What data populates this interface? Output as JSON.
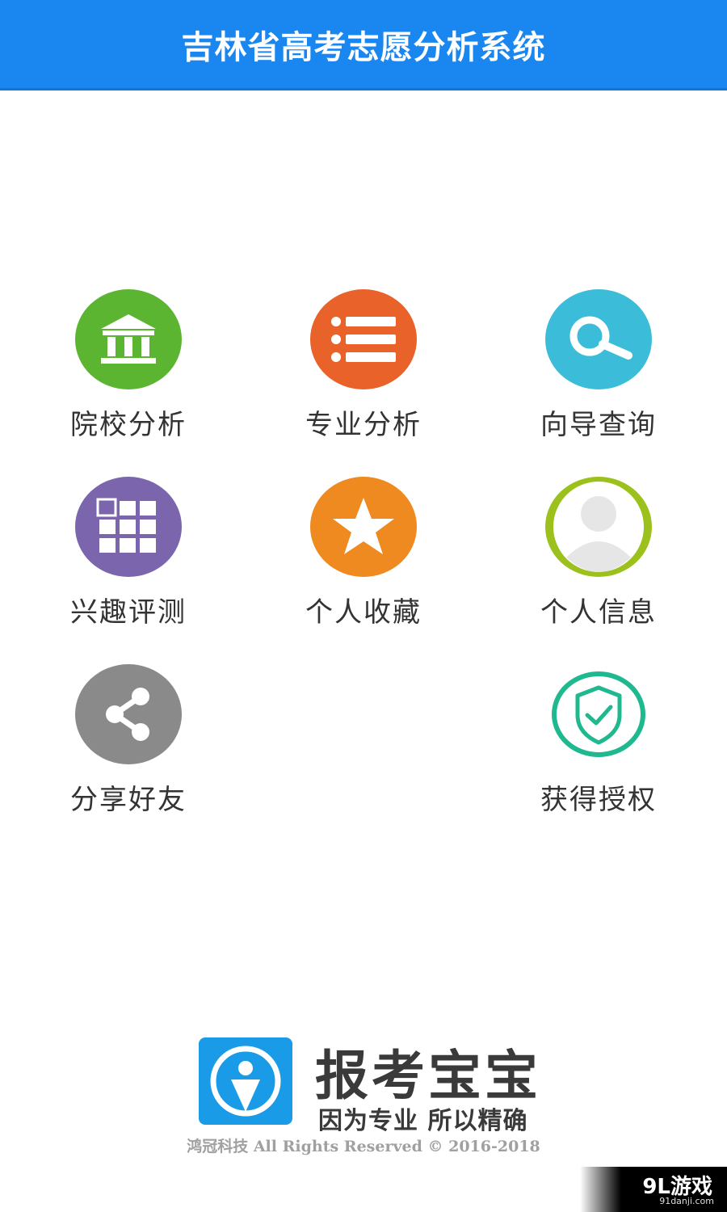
{
  "header": {
    "title": "吉林省高考志愿分析系统",
    "color": "#1a86f0"
  },
  "menu": {
    "items": [
      {
        "label": "院校分析",
        "icon": "institution-icon",
        "color": "#5cb531"
      },
      {
        "label": "专业分析",
        "icon": "list-icon",
        "color": "#e8622a"
      },
      {
        "label": "向导查询",
        "icon": "search-icon",
        "color": "#3bbcd8"
      },
      {
        "label": "兴趣评测",
        "icon": "grid-icon",
        "color": "#7b66ad"
      },
      {
        "label": "个人收藏",
        "icon": "star-icon",
        "color": "#ee8a1f"
      },
      {
        "label": "个人信息",
        "icon": "user-icon",
        "color": "#9cc11c"
      },
      {
        "label": "分享好友",
        "icon": "share-icon",
        "color": "#8a8a8a"
      },
      {
        "label": "获得授权",
        "icon": "shield-check-icon",
        "color": "#1fb88f"
      }
    ]
  },
  "brand": {
    "name": "报考宝宝",
    "slogan": "因为专业 所以精确",
    "copyright": "鸿冠科技 All Rights Reserved © 2016-2018",
    "logo_color": "#1a9be8"
  },
  "watermark": {
    "main": "9L游戏",
    "sub": "91danji.com"
  }
}
